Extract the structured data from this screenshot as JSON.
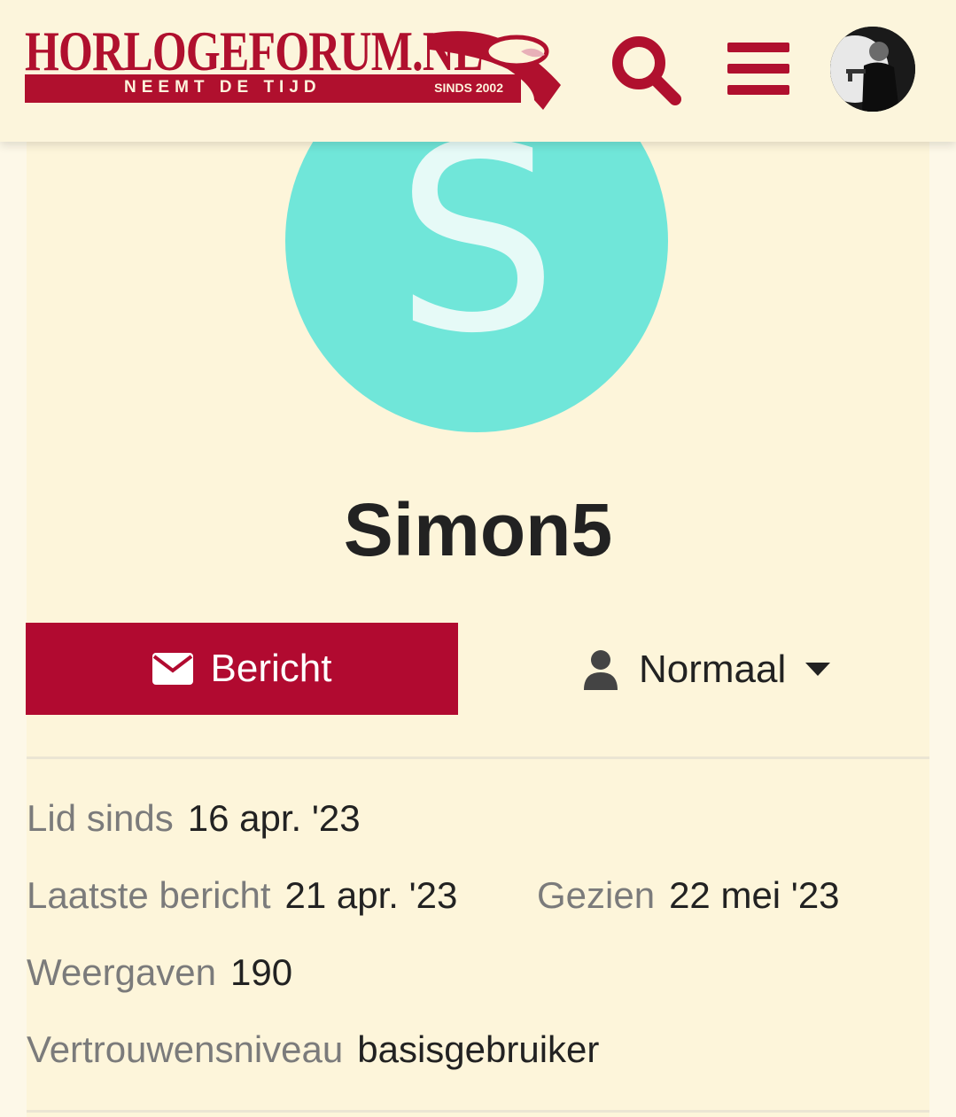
{
  "header": {
    "logo": {
      "title": "HORLOGEFORUM.NL",
      "tagline": "NEEMT DE TIJD",
      "since": "SINDS 2002"
    },
    "icons": [
      "search-icon",
      "hamburger-menu-icon",
      "user-avatar"
    ]
  },
  "profile": {
    "avatar_letter": "S",
    "avatar_color": "#70e6d9",
    "username": "Simon5",
    "message_button": "Bericht",
    "notification_level": "Normaal"
  },
  "stats": {
    "member_since": {
      "label": "Lid sinds",
      "value": "16 apr. '23"
    },
    "last_post": {
      "label": "Laatste bericht",
      "value": "21 apr. '23"
    },
    "seen": {
      "label": "Gezien",
      "value": "22 mei '23"
    },
    "views": {
      "label": "Weergaven",
      "value": "190"
    },
    "trust_level": {
      "label": "Vertrouwensniveau",
      "value": "basisgebruiker"
    }
  },
  "colors": {
    "brand": "#b0102e",
    "background": "#fdf5da"
  }
}
